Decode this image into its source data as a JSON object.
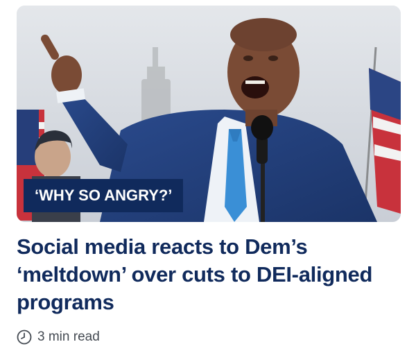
{
  "article": {
    "label": "‘WHY SO ANGRY?’",
    "headline": "Social media reacts to Dem’s ‘meltdown’ over cuts to DEI-aligned programs",
    "read_time": "3 min read",
    "hero_image": "man-speaking-at-microphone-photo",
    "read_time_icon": "clock-icon"
  },
  "colors": {
    "label_bg": "#102a5c",
    "headline": "#102a5c",
    "meta_text": "#444a52"
  }
}
